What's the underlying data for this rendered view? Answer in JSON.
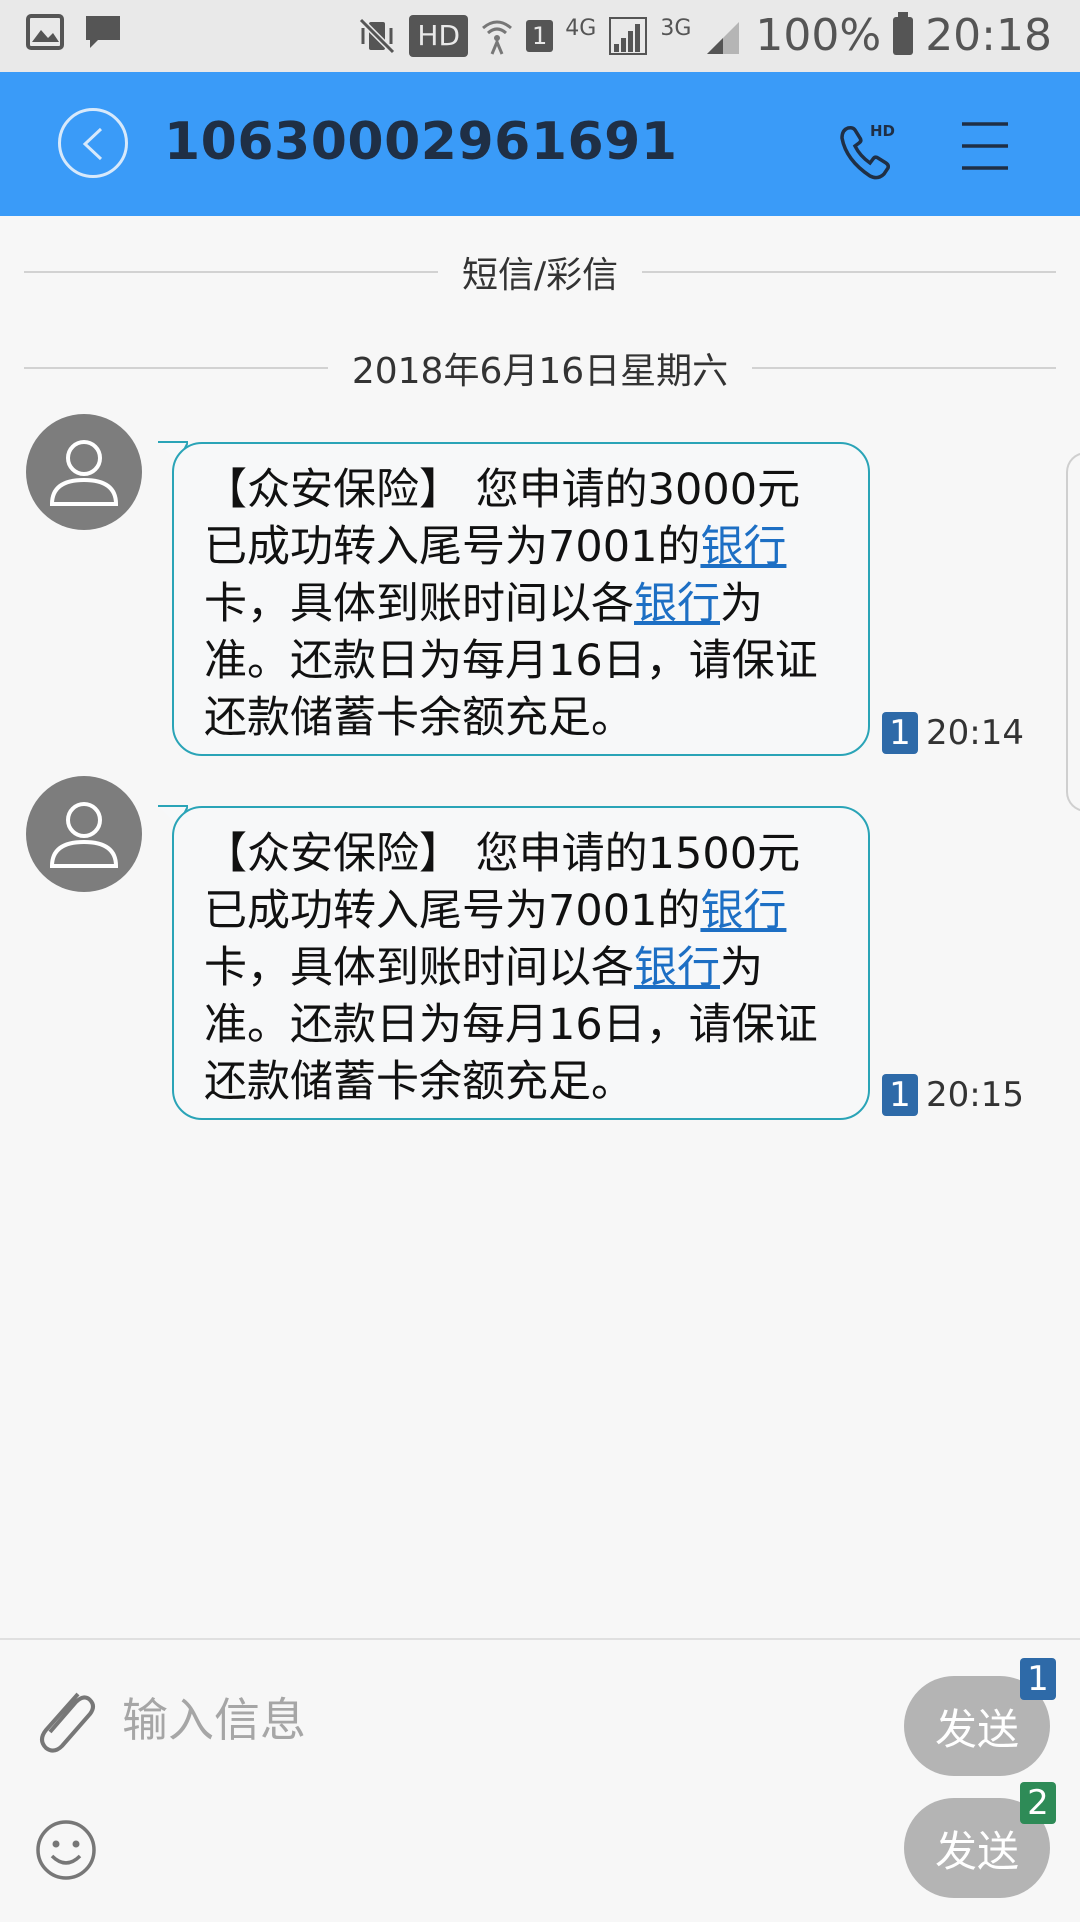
{
  "status_bar": {
    "network_4g": "4G",
    "network_3g": "3G",
    "hd_label": "HD",
    "sim_label": "1",
    "battery": "100%",
    "time": "20:18"
  },
  "header": {
    "title": "10630002961691",
    "call_hd_label": "HD"
  },
  "conversation": {
    "type_label": "短信/彩信",
    "date_label": "2018年6月16日星期六",
    "messages": [
      {
        "parts": [
          "【众安保险】 您申请的3000元已成功转入尾号为7001的",
          "银行",
          "卡，具体到账时间以各",
          "银行",
          "为准。还款日为每月16日，请保证还款储蓄卡余额充足。"
        ],
        "sim": "1",
        "time": "20:14"
      },
      {
        "parts": [
          "【众安保险】 您申请的1500元已成功转入尾号为7001的",
          "银行",
          "卡，具体到账时间以各",
          "银行",
          "为准。还款日为每月16日，请保证还款储蓄卡余额充足。"
        ],
        "sim": "1",
        "time": "20:15"
      }
    ]
  },
  "composer": {
    "placeholder": "输入信息",
    "send1_label": "发送",
    "send1_sim": "1",
    "send2_label": "发送",
    "send2_sim": "2"
  },
  "colors": {
    "appbar": "#3a9bf8",
    "bubble_border": "#2aa4b7",
    "link": "#1d6fc4",
    "sim1_badge": "#2e6aa8",
    "sim2_badge": "#2e8b57"
  }
}
